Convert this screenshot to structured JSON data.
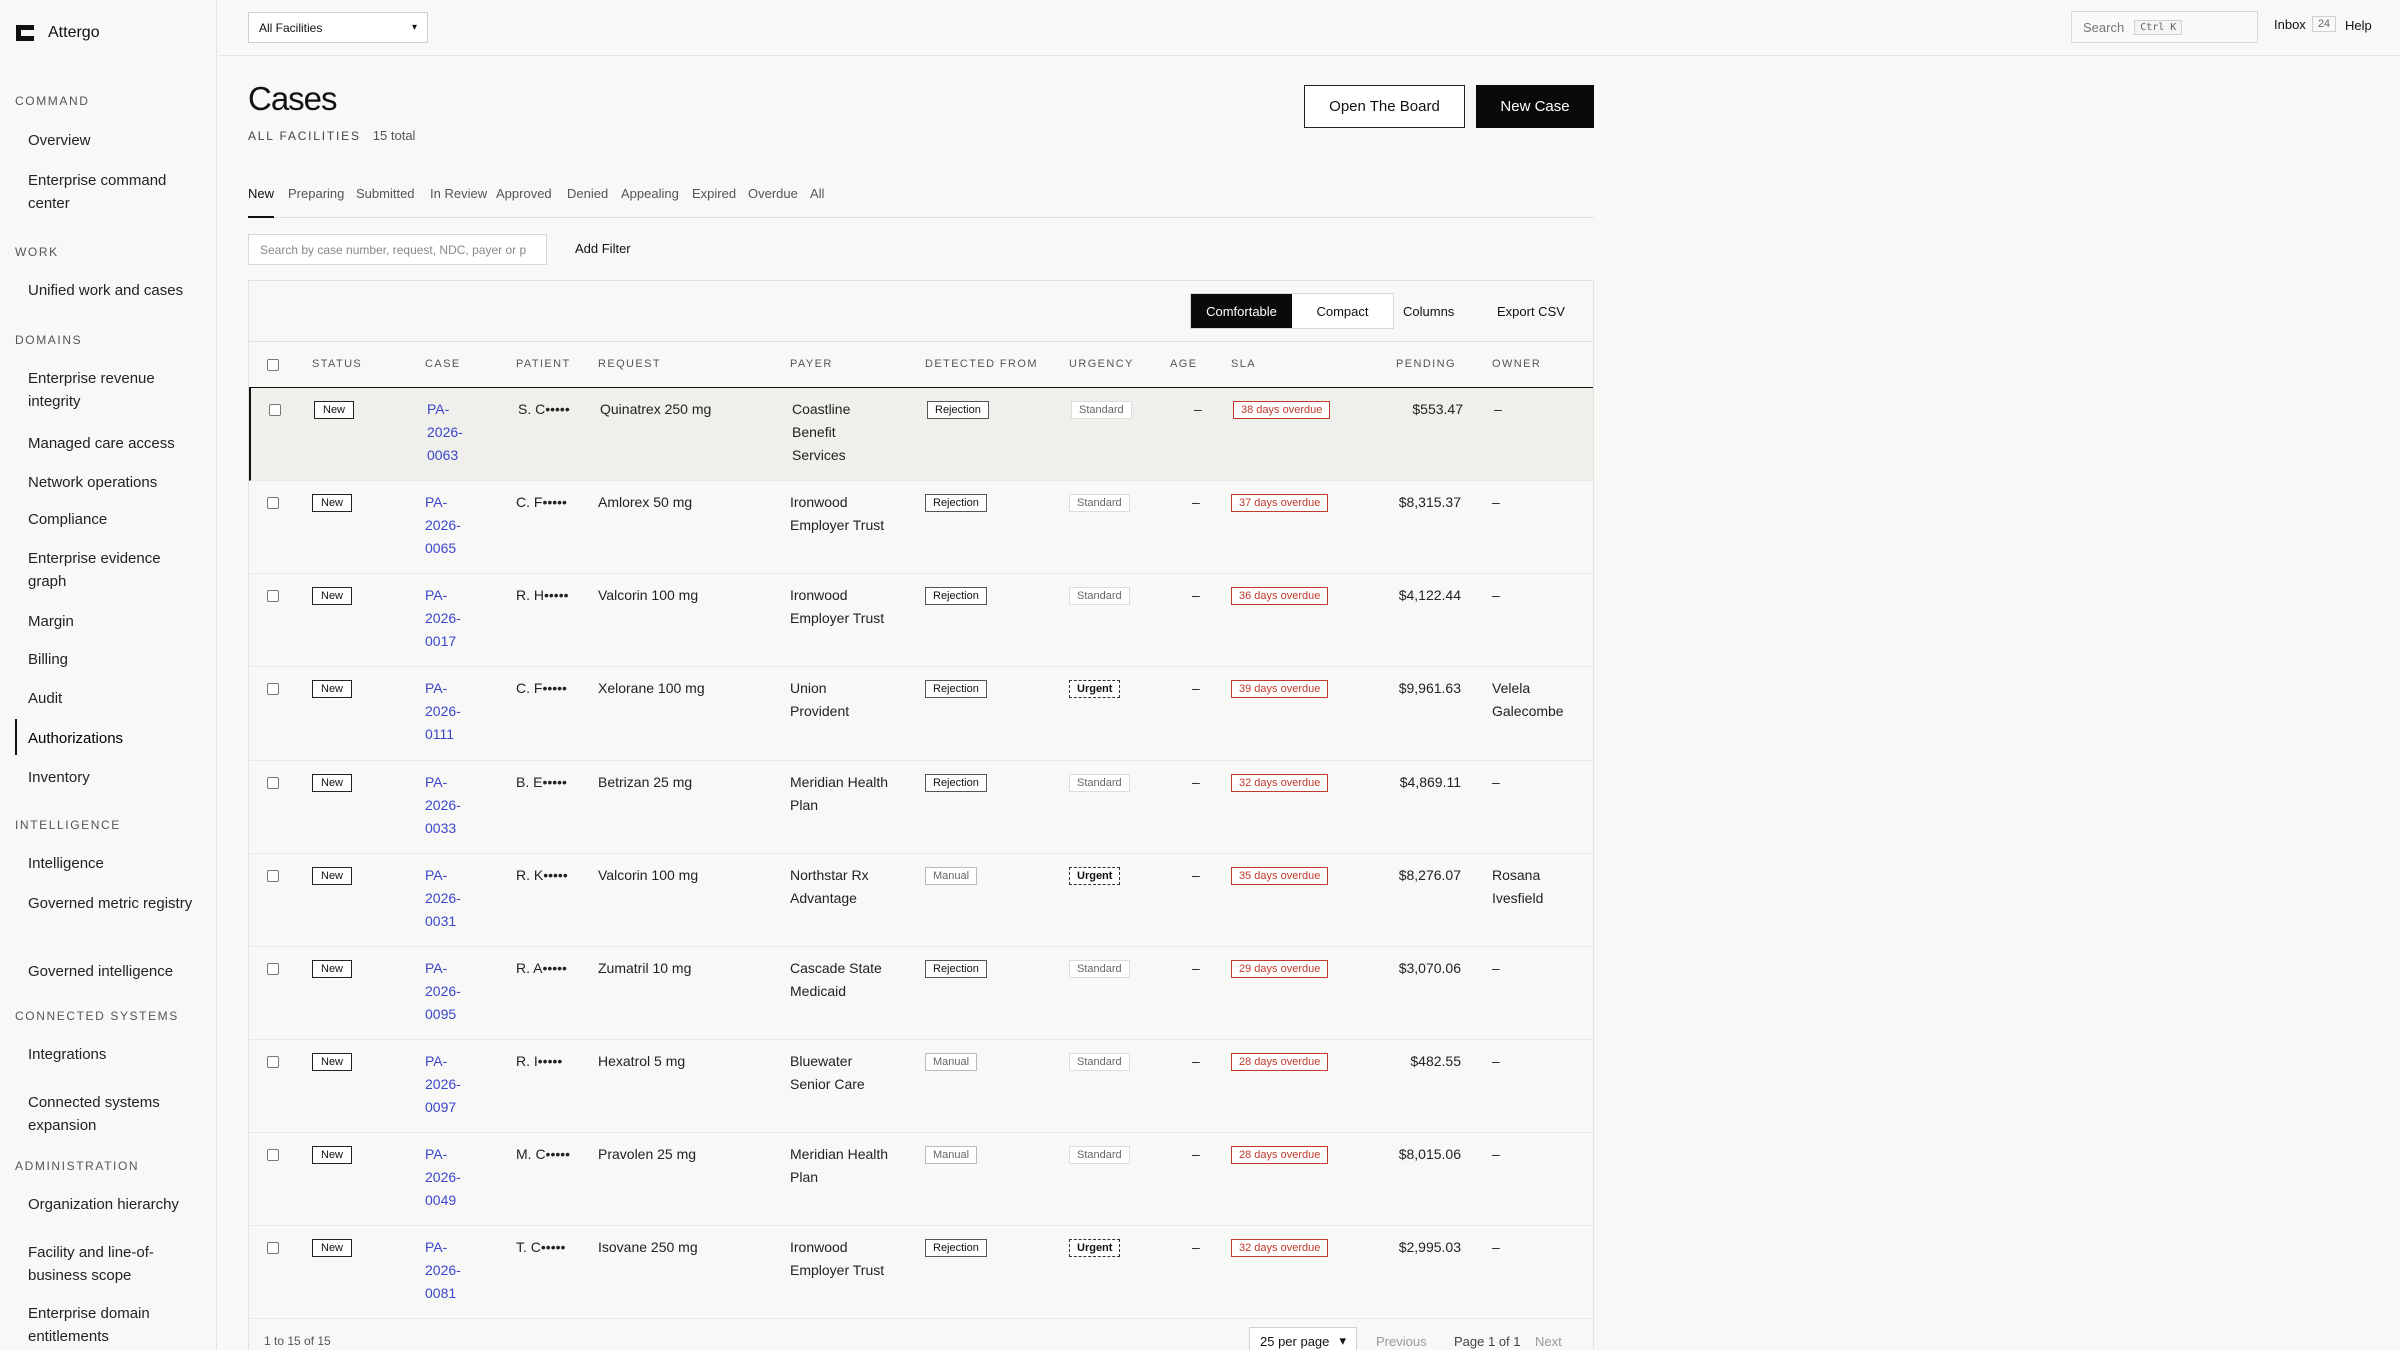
{
  "app": {
    "name": "Attergo"
  },
  "sidebar": {
    "sections": [
      {
        "label": "COMMAND",
        "items": [
          "Overview",
          "Enterprise command center"
        ]
      },
      {
        "label": "WORK",
        "items": [
          "Unified work and cases"
        ]
      },
      {
        "label": "DOMAINS",
        "items": [
          "Enterprise revenue integrity",
          "Managed care access",
          "Network operations",
          "Compliance",
          "Enterprise evidence graph",
          "Margin",
          "Billing",
          "Audit",
          "Authorizations",
          "Inventory"
        ]
      },
      {
        "label": "INTELLIGENCE",
        "items": [
          "Intelligence",
          "Governed metric registry",
          "Governed intelligence"
        ]
      },
      {
        "label": "CONNECTED SYSTEMS",
        "items": [
          "Integrations",
          "Connected systems expansion"
        ]
      },
      {
        "label": "ADMINISTRATION",
        "items": [
          "Organization hierarchy",
          "Facility and line-of-business scope",
          "Enterprise domain entitlements"
        ]
      }
    ],
    "active_item": "Authorizations"
  },
  "topbar": {
    "facility": "All Facilities",
    "search_label": "Search",
    "search_shortcut": "Ctrl K",
    "inbox_label": "Inbox",
    "inbox_count": "24",
    "help_label": "Help"
  },
  "header": {
    "title": "Cases",
    "scope": "ALL FACILITIES",
    "total": "15 total",
    "board_button": "Open The Board",
    "new_button": "New Case"
  },
  "tabs": [
    "New",
    "Preparing",
    "Submitted",
    "In Review",
    "Approved",
    "Denied",
    "Appealing",
    "Expired",
    "Overdue",
    "All"
  ],
  "active_tab": "New",
  "toolbar": {
    "search_placeholder": "Search by case number, request, NDC, payer or p",
    "add_filter": "Add Filter",
    "comfortable": "Comfortable",
    "compact": "Compact",
    "columns": "Columns",
    "export": "Export CSV"
  },
  "table": {
    "columns": [
      "STATUS",
      "CASE",
      "PATIENT",
      "REQUEST",
      "PAYER",
      "DETECTED FROM",
      "URGENCY",
      "AGE",
      "SLA",
      "PENDING",
      "OWNER"
    ],
    "rows": [
      {
        "status": "New",
        "case": [
          "PA-",
          "2026-",
          "0063"
        ],
        "patient": "S. C•••••",
        "request": "Quinatrex 250 mg",
        "payer": [
          "Coastline",
          "Benefit",
          "Services"
        ],
        "source": "Rejection",
        "urgency": "Standard",
        "age": "–",
        "sla": "38 days overdue",
        "pending": "$553.47",
        "owner": [
          "–"
        ]
      },
      {
        "status": "New",
        "case": [
          "PA-",
          "2026-",
          "0065"
        ],
        "patient": "C. F•••••",
        "request": "Amlorex 50 mg",
        "payer": [
          "Ironwood",
          "Employer Trust"
        ],
        "source": "Rejection",
        "urgency": "Standard",
        "age": "–",
        "sla": "37 days overdue",
        "pending": "$8,315.37",
        "owner": [
          "–"
        ]
      },
      {
        "status": "New",
        "case": [
          "PA-",
          "2026-",
          "0017"
        ],
        "patient": "R. H•••••",
        "request": "Valcorin 100 mg",
        "payer": [
          "Ironwood",
          "Employer Trust"
        ],
        "source": "Rejection",
        "urgency": "Standard",
        "age": "–",
        "sla": "36 days overdue",
        "pending": "$4,122.44",
        "owner": [
          "–"
        ]
      },
      {
        "status": "New",
        "case": [
          "PA-",
          "2026-",
          "0111"
        ],
        "patient": "C. F•••••",
        "request": "Xelorane 100 mg",
        "payer": [
          "Union",
          "Provident"
        ],
        "source": "Rejection",
        "urgency": "Urgent",
        "age": "–",
        "sla": "39 days overdue",
        "pending": "$9,961.63",
        "owner": [
          "Velela",
          "Galecombe"
        ]
      },
      {
        "status": "New",
        "case": [
          "PA-",
          "2026-",
          "0033"
        ],
        "patient": "B. E•••••",
        "request": "Betrizan 25 mg",
        "payer": [
          "Meridian Health",
          "Plan"
        ],
        "source": "Rejection",
        "urgency": "Standard",
        "age": "–",
        "sla": "32 days overdue",
        "pending": "$4,869.11",
        "owner": [
          "–"
        ]
      },
      {
        "status": "New",
        "case": [
          "PA-",
          "2026-",
          "0031"
        ],
        "patient": "R. K•••••",
        "request": "Valcorin 100 mg",
        "payer": [
          "Northstar Rx",
          "Advantage"
        ],
        "source": "Manual",
        "urgency": "Urgent",
        "age": "–",
        "sla": "35 days overdue",
        "pending": "$8,276.07",
        "owner": [
          "Rosana",
          "Ivesfield"
        ]
      },
      {
        "status": "New",
        "case": [
          "PA-",
          "2026-",
          "0095"
        ],
        "patient": "R. A•••••",
        "request": "Zumatril 10 mg",
        "payer": [
          "Cascade State",
          "Medicaid"
        ],
        "source": "Rejection",
        "urgency": "Standard",
        "age": "–",
        "sla": "29 days overdue",
        "pending": "$3,070.06",
        "owner": [
          "–"
        ]
      },
      {
        "status": "New",
        "case": [
          "PA-",
          "2026-",
          "0097"
        ],
        "patient": "R. I•••••",
        "request": "Hexatrol 5 mg",
        "payer": [
          "Bluewater",
          "Senior Care"
        ],
        "source": "Manual",
        "urgency": "Standard",
        "age": "–",
        "sla": "28 days overdue",
        "pending": "$482.55",
        "owner": [
          "–"
        ]
      },
      {
        "status": "New",
        "case": [
          "PA-",
          "2026-",
          "0049"
        ],
        "patient": "M. C•••••",
        "request": "Pravolen 25 mg",
        "payer": [
          "Meridian Health",
          "Plan"
        ],
        "source": "Manual",
        "urgency": "Standard",
        "age": "–",
        "sla": "28 days overdue",
        "pending": "$8,015.06",
        "owner": [
          "–"
        ]
      },
      {
        "status": "New",
        "case": [
          "PA-",
          "2026-",
          "0081"
        ],
        "patient": "T. C•••••",
        "request": "Isovane 250 mg",
        "payer": [
          "Ironwood",
          "Employer Trust"
        ],
        "source": "Rejection",
        "urgency": "Urgent",
        "age": "–",
        "sla": "32 days overdue",
        "pending": "$2,995.03",
        "owner": [
          "–"
        ]
      }
    ]
  },
  "pagination": {
    "range": "1 to 15 of 15",
    "per_page": "25 per page",
    "previous": "Previous",
    "page": "Page 1 of 1",
    "next": "Next"
  },
  "colors": {
    "accent": "#0a0a0a",
    "link": "#3b46c9",
    "overdue": "#c0392b"
  }
}
